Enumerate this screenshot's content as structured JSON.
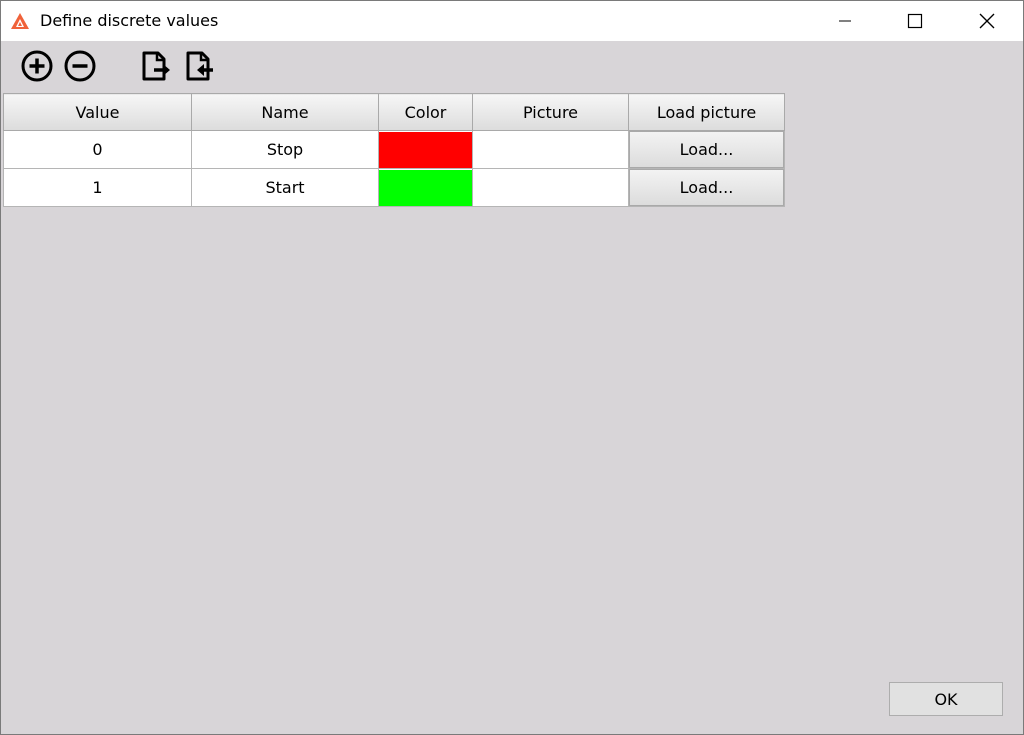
{
  "window": {
    "title": "Define discrete values"
  },
  "toolbar": {
    "buttons": [
      {
        "icon": "add-circle-icon"
      },
      {
        "icon": "remove-circle-icon"
      },
      {
        "icon": "export-file-icon"
      },
      {
        "icon": "import-file-icon"
      }
    ]
  },
  "table": {
    "columns": [
      "Value",
      "Name",
      "Color",
      "Picture",
      "Load picture"
    ],
    "rows": [
      {
        "value": "0",
        "name": "Stop",
        "color": "#ff0000",
        "picture": "",
        "load_label": "Load..."
      },
      {
        "value": "1",
        "name": "Start",
        "color": "#00ff00",
        "picture": "",
        "load_label": "Load..."
      }
    ]
  },
  "footer": {
    "ok_label": "OK"
  }
}
